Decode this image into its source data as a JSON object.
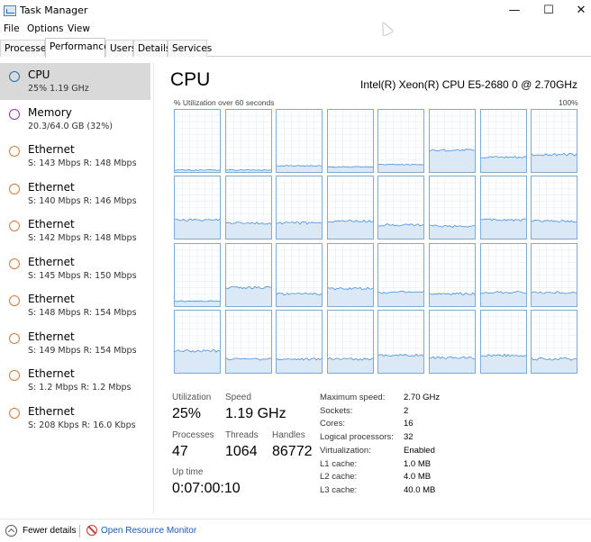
{
  "window": {
    "title": "Task Manager",
    "minimize_glyph": "—",
    "maximize_glyph": "☐",
    "close_glyph": "✕"
  },
  "menu": [
    "File",
    "Options",
    "View"
  ],
  "tabs": [
    "Processes",
    "Performance",
    "Users",
    "Details",
    "Services"
  ],
  "active_tab": "Performance",
  "sidebar": [
    {
      "name": "CPU",
      "sub": "25%  1.19 GHz",
      "ring_color": "#1f6fbf",
      "selected": true
    },
    {
      "name": "Memory",
      "sub": "20.3/64.0 GB (32%)",
      "ring_color": "#9b2fae",
      "selected": false
    },
    {
      "name": "Ethernet",
      "sub": "S: 143 Mbps  R: 148 Mbps",
      "ring_color": "#d77a3a",
      "selected": false
    },
    {
      "name": "Ethernet",
      "sub": "S: 140 Mbps  R: 146 Mbps",
      "ring_color": "#d77a3a",
      "selected": false
    },
    {
      "name": "Ethernet",
      "sub": "S: 142 Mbps  R: 148 Mbps",
      "ring_color": "#d77a3a",
      "selected": false
    },
    {
      "name": "Ethernet",
      "sub": "S: 145 Mbps  R: 150 Mbps",
      "ring_color": "#d77a3a",
      "selected": false
    },
    {
      "name": "Ethernet",
      "sub": "S: 148 Mbps  R: 154 Mbps",
      "ring_color": "#d77a3a",
      "selected": false
    },
    {
      "name": "Ethernet",
      "sub": "S: 149 Mbps  R: 154 Mbps",
      "ring_color": "#d77a3a",
      "selected": false
    },
    {
      "name": "Ethernet",
      "sub": "S: 1.2 Mbps  R: 1.2 Mbps",
      "ring_color": "#d77a3a",
      "selected": false
    },
    {
      "name": "Ethernet",
      "sub": "S: 208 Kbps  R: 16.0 Kbps",
      "ring_color": "#d77a3a",
      "selected": false
    }
  ],
  "main": {
    "title": "CPU",
    "cpu_model": "Intel(R) Xeon(R) CPU E5-2680 0 @ 2.70GHz",
    "graph_label": "% Utilization over 60 seconds",
    "graph_max": "100%",
    "graph_colors": {
      "border": "#7eaad3",
      "line": "#4a90d9",
      "fill": "#dbe9f6"
    },
    "core_levels": [
      3,
      3,
      10,
      8,
      12,
      35,
      24,
      28,
      30,
      25,
      25,
      28,
      22,
      20,
      30,
      28,
      8,
      30,
      20,
      28,
      22,
      20,
      22,
      22,
      35,
      22,
      22,
      22,
      28,
      24,
      28,
      22
    ]
  },
  "stats": {
    "utilization_label": "Utilization",
    "utilization": "25%",
    "speed_label": "Speed",
    "speed": "1.19 GHz",
    "processes_label": "Processes",
    "processes": "47",
    "threads_label": "Threads",
    "threads": "1064",
    "handles_label": "Handles",
    "handles": "86772",
    "uptime_label": "Up time",
    "uptime": "0:07:00:10"
  },
  "specs": [
    {
      "key": "Maximum speed:",
      "value": "2.70 GHz"
    },
    {
      "key": "Sockets:",
      "value": "2"
    },
    {
      "key": "Cores:",
      "value": "16"
    },
    {
      "key": "Logical processors:",
      "value": "32"
    },
    {
      "key": "Virtualization:",
      "value": "Enabled"
    },
    {
      "key": "L1 cache:",
      "value": "1.0 MB"
    },
    {
      "key": "L2 cache:",
      "value": "4.0 MB"
    },
    {
      "key": "L3 cache:",
      "value": "40.0 MB"
    }
  ],
  "footer": {
    "fewer_details": "Fewer details",
    "open_resource_monitor": "Open Resource Monitor"
  }
}
